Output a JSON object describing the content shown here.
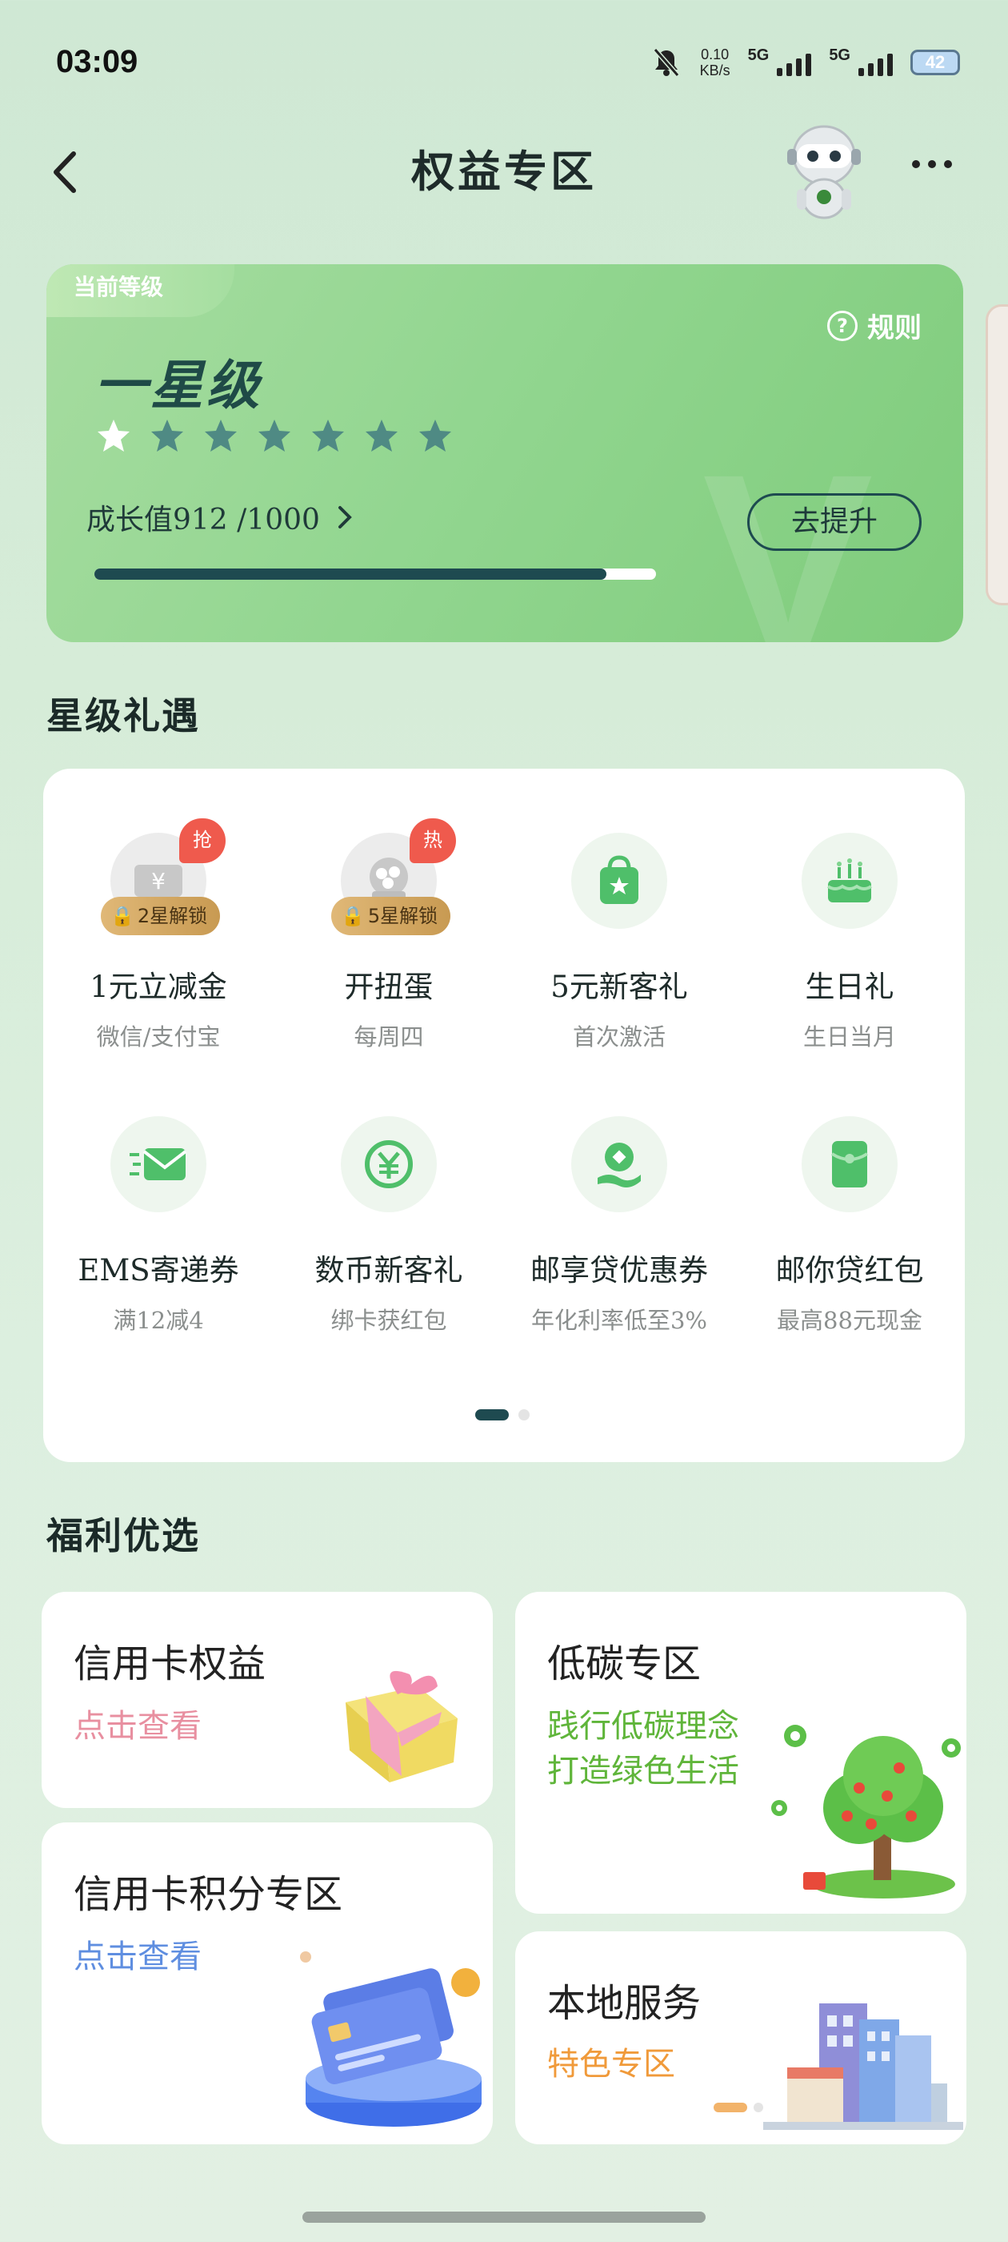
{
  "status_bar": {
    "time": "03:09",
    "net_speed_value": "0.10",
    "net_speed_unit": "KB/s",
    "sim1": "5G",
    "sim2": "5G",
    "battery": "42"
  },
  "nav": {
    "title": "权益专区"
  },
  "level_card": {
    "tag": "当前等级",
    "rules_label": "规则",
    "level_name": "一星级",
    "stars_total": 7,
    "stars_filled": 1,
    "growth_label": "成长值912 /1000",
    "progress": 0.912,
    "upgrade_button": "去提升",
    "watermark": "V"
  },
  "star_perks": {
    "title": "星级礼遇",
    "items": [
      {
        "name": "1元立减金",
        "sub": "微信/支付宝",
        "badge": "抢",
        "lock": "2星解锁",
        "icon": "yen-coin-icon"
      },
      {
        "name": "开扭蛋",
        "sub": "每周四",
        "badge": "热",
        "lock": "5星解锁",
        "icon": "gacha-icon"
      },
      {
        "name": "5元新客礼",
        "sub": "首次激活",
        "badge": "",
        "lock": "",
        "icon": "shopping-bag-icon"
      },
      {
        "name": "生日礼",
        "sub": "生日当月",
        "badge": "",
        "lock": "",
        "icon": "birthday-cake-icon"
      },
      {
        "name": "EMS寄递券",
        "sub": "满12减4",
        "badge": "",
        "lock": "",
        "icon": "mail-envelope-icon"
      },
      {
        "name": "数币新客礼",
        "sub": "绑卡获红包",
        "badge": "",
        "lock": "",
        "icon": "digital-yuan-icon"
      },
      {
        "name": "邮享贷优惠券",
        "sub": "年化利率低至3%",
        "badge": "",
        "lock": "",
        "icon": "loan-hand-icon"
      },
      {
        "name": "邮你贷红包",
        "sub": "最高88元现金",
        "badge": "",
        "lock": "",
        "icon": "red-packet-icon"
      }
    ],
    "page_index": 1,
    "page_count": 2
  },
  "welfare": {
    "title": "福利优选",
    "tiles": [
      {
        "title": "信用卡权益",
        "sub": "点击查看",
        "sub_color": "#e88fa0"
      },
      {
        "title": "信用卡积分专区",
        "sub": "点击查看",
        "sub_color": "#5f8ee0"
      },
      {
        "title": "低碳专区",
        "sub_line1": "践行低碳理念",
        "sub_line2": "打造绿色生活",
        "sub_color": "#5fb53a"
      },
      {
        "title": "本地服务",
        "sub": "特色专区",
        "sub_color": "#f09a3a"
      }
    ]
  },
  "colors": {
    "accent_dark": "#1e4a50",
    "card_green": "#92d690",
    "badge_red": "#ef5a4d"
  }
}
